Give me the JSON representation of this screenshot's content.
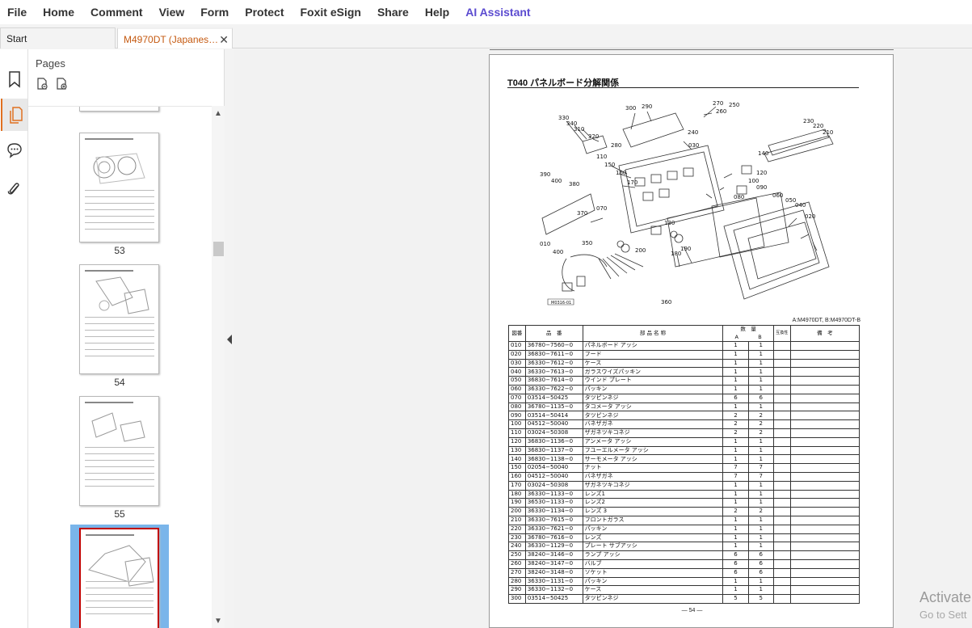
{
  "menu": {
    "items": [
      "File",
      "Home",
      "Comment",
      "View",
      "Form",
      "Protect",
      "Foxit eSign",
      "Share",
      "Help",
      "AI Assistant"
    ]
  },
  "tabs": {
    "start": "Start",
    "document": "M4970DT (Japanese)..."
  },
  "pages_panel": {
    "title": "Pages",
    "thumbnails": [
      {
        "page": "53"
      },
      {
        "page": "54"
      },
      {
        "page": "55"
      }
    ]
  },
  "document": {
    "heading": "T040 パネルボード分解関係",
    "model_note": "A:M4970DT,  B:M4970DT-B",
    "page_number": "— 54 —",
    "table": {
      "headers": {
        "no": "図番",
        "part_no": "品　番",
        "name": "部 品 名 称",
        "qty": "数　量",
        "a": "A",
        "b": "B",
        "compat": "互換性",
        "note": "備　考"
      },
      "rows": [
        [
          "010",
          "36780−7560−0",
          "パネルボード アッシ",
          "1",
          "1"
        ],
        [
          "020",
          "36830−7611−0",
          "フード",
          "1",
          "1"
        ],
        [
          "030",
          "36330−7612−0",
          "ケース",
          "1",
          "1"
        ],
        [
          "040",
          "36330−7613−0",
          "ガラスウイズパッキン",
          "1",
          "1"
        ],
        [
          "050",
          "36830−7614−0",
          "ウインド プレート",
          "1",
          "1"
        ],
        [
          "060",
          "36330−7622−0",
          "パッキン",
          "1",
          "1"
        ],
        [
          "070",
          "03514−50425",
          "タツピンネジ",
          "6",
          "6"
        ],
        [
          "080",
          "36780−1135−0",
          "タコメータ アッシ",
          "1",
          "1"
        ],
        [
          "090",
          "03514−50414",
          "タツピンネジ",
          "2",
          "2"
        ],
        [
          "100",
          "04512−50040",
          "バネザガネ",
          "2",
          "2"
        ],
        [
          "110",
          "03024−50308",
          "ザガネツキコネジ",
          "2",
          "2"
        ],
        [
          "120",
          "36830−1136−0",
          "アンメータ アッシ",
          "1",
          "1"
        ],
        [
          "130",
          "36830−1137−0",
          "フユーエルメータ アッシ",
          "1",
          "1"
        ],
        [
          "140",
          "36830−1138−0",
          "サーモメータ アッシ",
          "1",
          "1"
        ],
        [
          "150",
          "02054−50040",
          "ナット",
          "7",
          "7"
        ],
        [
          "160",
          "04512−50040",
          "バネザガネ",
          "7",
          "7"
        ],
        [
          "170",
          "03024−50308",
          "ザガネツキコネジ",
          "1",
          "1"
        ],
        [
          "180",
          "36330−1133−0",
          "レンズ1",
          "1",
          "1"
        ],
        [
          "190",
          "36530−1133−0",
          "レンズ2",
          "1",
          "1"
        ],
        [
          "200",
          "36330−1134−0",
          "レンズ 3",
          "2",
          "2"
        ],
        [
          "210",
          "36330−7615−0",
          "フロントガラス",
          "1",
          "1"
        ],
        [
          "220",
          "36330−7621−0",
          "パッキン",
          "1",
          "1"
        ],
        [
          "230",
          "36780−7616−0",
          "レンズ",
          "1",
          "1"
        ],
        [
          "240",
          "36330−1129−0",
          "プレート サブアッシ",
          "1",
          "1"
        ],
        [
          "250",
          "38240−3146−0",
          "ランプ アッシ",
          "6",
          "6"
        ],
        [
          "260",
          "38240−3147−0",
          "バルブ",
          "6",
          "6"
        ],
        [
          "270",
          "38240−3148−0",
          "ソケット",
          "6",
          "6"
        ],
        [
          "280",
          "36330−1131−0",
          "パッキン",
          "1",
          "1"
        ],
        [
          "290",
          "36330−1132−0",
          "ケース",
          "1",
          "1"
        ],
        [
          "300",
          "03514−50425",
          "タツピンネジ",
          "5",
          "5"
        ]
      ]
    },
    "diagram_labels": [
      "330",
      "340",
      "310",
      "320",
      "300",
      "290",
      "270",
      "250",
      "260",
      "240",
      "230",
      "220",
      "210",
      "280",
      "030",
      "140",
      "120",
      "100",
      "090",
      "110",
      "150",
      "160",
      "170",
      "390",
      "400",
      "380",
      "070",
      "370",
      "060",
      "050",
      "040",
      "080",
      "130",
      "020",
      "010",
      "400",
      "350",
      "200",
      "190",
      "180",
      "360",
      "M0316-01"
    ]
  },
  "watermark": {
    "line1": "Activate",
    "line2": "Go to Sett"
  }
}
